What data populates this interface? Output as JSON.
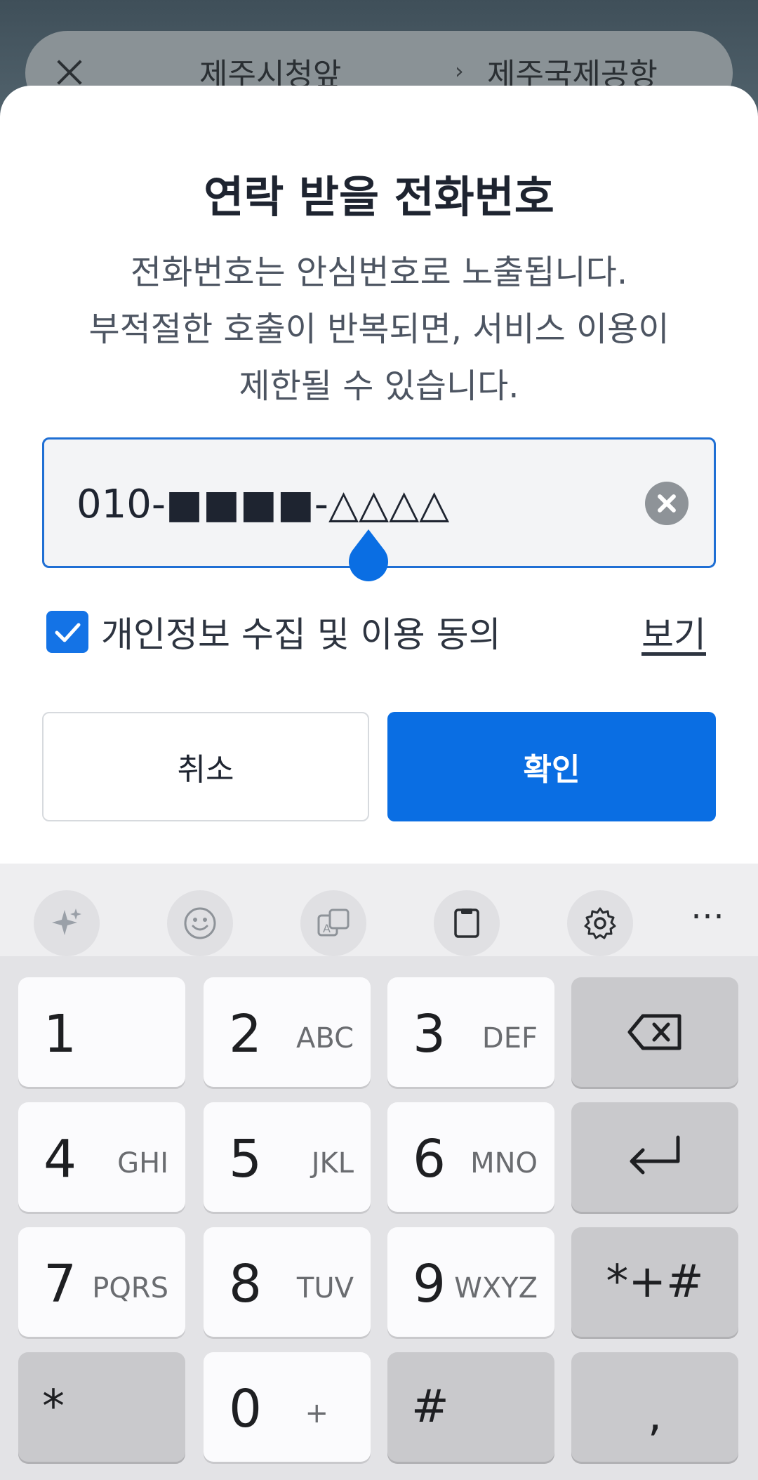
{
  "background": {
    "route_from": "제주시청앞",
    "route_arrow": "›",
    "route_to": "제주국제공항"
  },
  "dialog": {
    "title": "연락 받을 전화번호",
    "description_lines": [
      "전화번호는 안심번호로 노출됩니다.",
      "부적절한 호출이 반복되면, 서비스 이용이",
      "제한될 수 있습니다."
    ],
    "phone_value": "010-■■■■-△△△△",
    "consent_label": "개인정보 수집 및 이용 동의",
    "consent_checked": true,
    "consent_view": "보기",
    "cancel_label": "취소",
    "confirm_label": "확인"
  },
  "keyboard": {
    "toolbar_icons": [
      "ai-sparkle-icon",
      "emoji-icon",
      "translate-icon",
      "clipboard-icon",
      "settings-icon",
      "more-icon"
    ],
    "toolbar_more": "⋯",
    "rows": [
      [
        {
          "num": "1",
          "letters": ""
        },
        {
          "num": "2",
          "letters": "ABC"
        },
        {
          "num": "3",
          "letters": "DEF"
        },
        {
          "icon": "backspace-icon"
        }
      ],
      [
        {
          "num": "4",
          "letters": "GHI"
        },
        {
          "num": "5",
          "letters": "JKL"
        },
        {
          "num": "6",
          "letters": "MNO"
        },
        {
          "icon": "enter-icon"
        }
      ],
      [
        {
          "num": "7",
          "letters": "PQRS"
        },
        {
          "num": "8",
          "letters": "TUV"
        },
        {
          "num": "9",
          "letters": "WXYZ"
        },
        {
          "label": "*+#"
        }
      ],
      [
        {
          "label": "*"
        },
        {
          "num": "0",
          "letters": "+"
        },
        {
          "label": "#"
        },
        {
          "label": ","
        }
      ]
    ]
  },
  "colors": {
    "accent": "#0a6ee3",
    "field_border": "#1f6fd4",
    "field_bg": "#f3f4f6"
  }
}
